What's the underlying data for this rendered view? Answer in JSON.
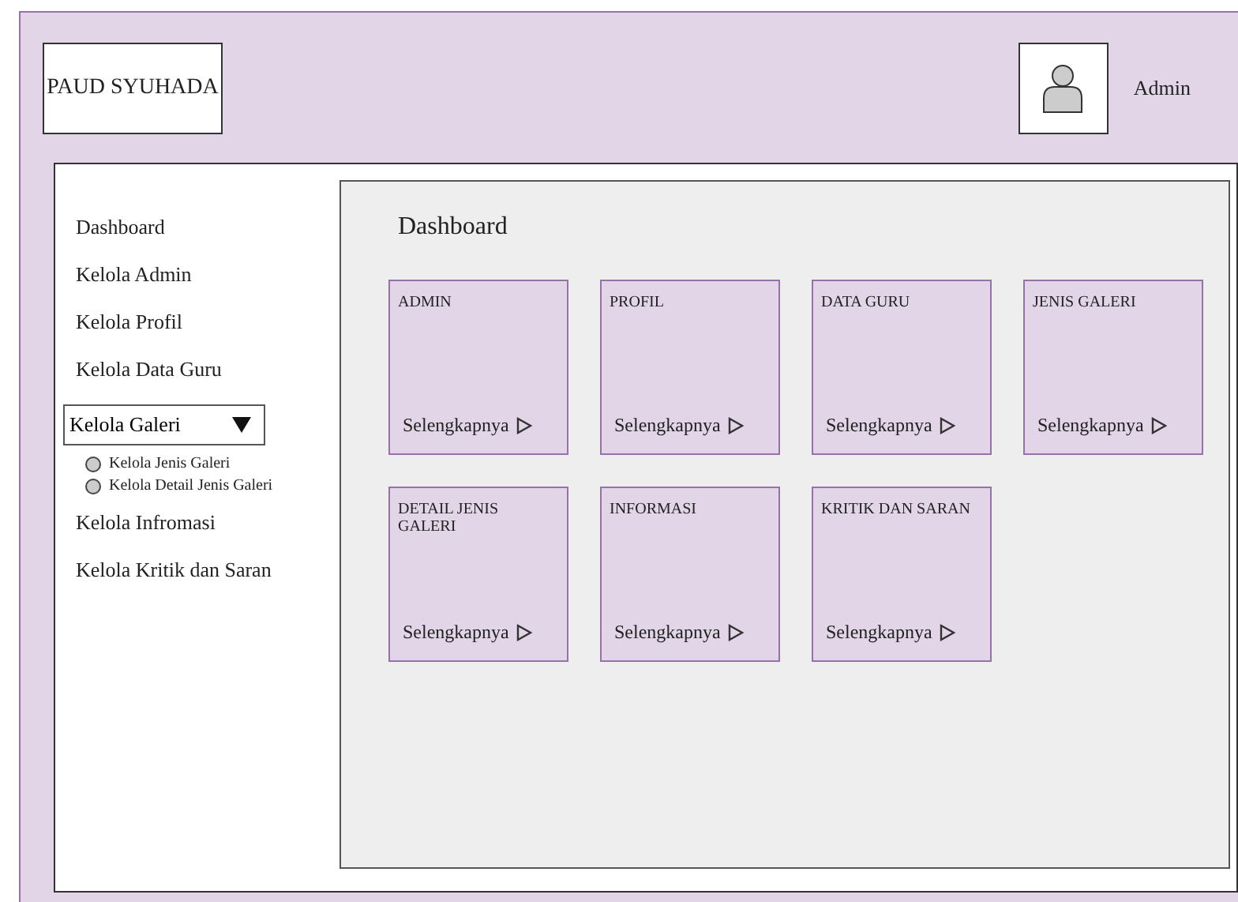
{
  "header": {
    "logo": "PAUD SYUHADA",
    "user": "Admin"
  },
  "sidebar": {
    "items": [
      {
        "kind": "link",
        "label": "Dashboard"
      },
      {
        "kind": "link",
        "label": "Kelola Admin"
      },
      {
        "kind": "link",
        "label": "Kelola Profil"
      },
      {
        "kind": "link",
        "label": "Kelola Data Guru"
      },
      {
        "kind": "dropdown",
        "label": "Kelola Galeri",
        "expanded": true,
        "children": [
          {
            "label": "Kelola Jenis Galeri",
            "selected": false
          },
          {
            "label": "Kelola Detail Jenis Galeri",
            "selected": false
          }
        ]
      },
      {
        "kind": "link",
        "label": "Kelola Infromasi"
      },
      {
        "kind": "link",
        "label": "Kelola Kritik dan Saran"
      }
    ]
  },
  "content": {
    "title": "Dashboard",
    "cards": [
      {
        "title": "ADMIN",
        "link": "Selengkapnya"
      },
      {
        "title": "PROFIL",
        "link": "Selengkapnya"
      },
      {
        "title": "DATA GURU",
        "link": "Selengkapnya"
      },
      {
        "title": "JENIS GALERI",
        "link": "Selengkapnya"
      },
      {
        "title": "DETAIL JENIS GALERI",
        "link": "Selengkapnya"
      },
      {
        "title": "INFORMASI",
        "link": "Selengkapnya"
      },
      {
        "title": "KRITIK DAN SARAN",
        "link": "Selengkapnya"
      }
    ]
  }
}
